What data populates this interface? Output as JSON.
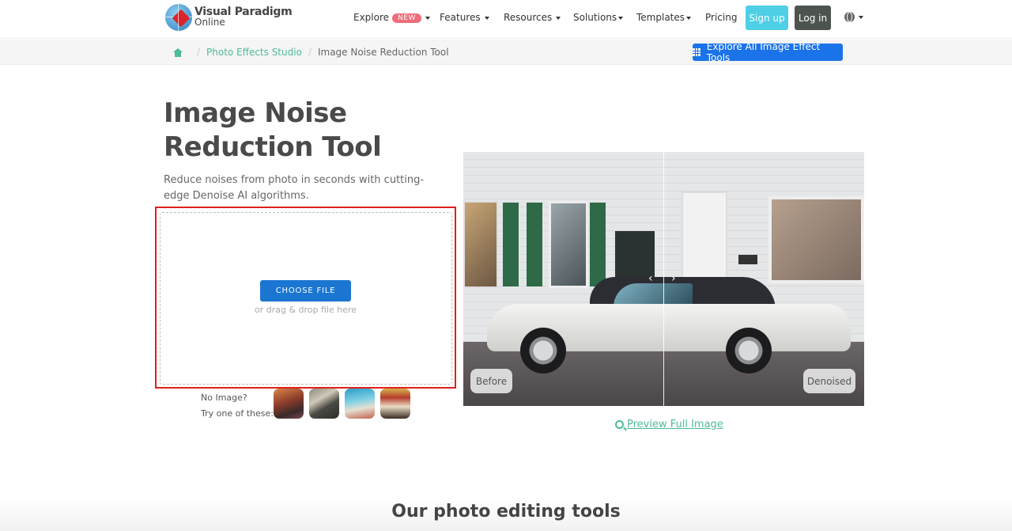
{
  "logo": {
    "line1": "Visual Paradigm",
    "line2": "Online"
  },
  "nav": {
    "items": [
      {
        "label": "Explore",
        "badge": "NEW",
        "has_caret": true
      },
      {
        "label": "Features",
        "has_caret": true
      },
      {
        "label": "Resources",
        "has_caret": true
      },
      {
        "label": "Solutions",
        "has_caret": true
      },
      {
        "label": "Templates",
        "has_caret": true
      },
      {
        "label": "Pricing",
        "has_caret": false
      }
    ],
    "signup": "Sign up",
    "login": "Log in",
    "language_icon": "globe-icon"
  },
  "breadcrumb": {
    "home_icon": "home-icon",
    "items": [
      "Photo Effects Studio",
      "Image Noise Reduction Tool"
    ],
    "separator": "/"
  },
  "explore_all_button": "Explore All Image Effect Tools",
  "hero": {
    "title": "Image Noise Reduction Tool",
    "subtitle": "Reduce noises from photo in seconds with cutting-edge Denoise AI algorithms."
  },
  "upload": {
    "button": "CHOOSE FILE",
    "hint": "or drag & drop file here"
  },
  "samples": {
    "line1": "No Image?",
    "line2": "Try one of these:",
    "thumbs": [
      "sample-street-cars",
      "sample-interior",
      "sample-train",
      "sample-band"
    ]
  },
  "compare": {
    "before_label": "Before",
    "after_label": "Denoised",
    "handle_left": "‹",
    "handle_right": "›"
  },
  "preview_link": "Preview Full Image",
  "section": {
    "title": "Our photo editing tools"
  },
  "colors": {
    "accent_green": "#4fbb96",
    "primary_blue": "#1a73e8",
    "signup_cyan": "#4ecfe5",
    "login_dark": "#4d544e",
    "highlight_red": "#e0201c",
    "badge_pink": "#ef6c7a"
  }
}
